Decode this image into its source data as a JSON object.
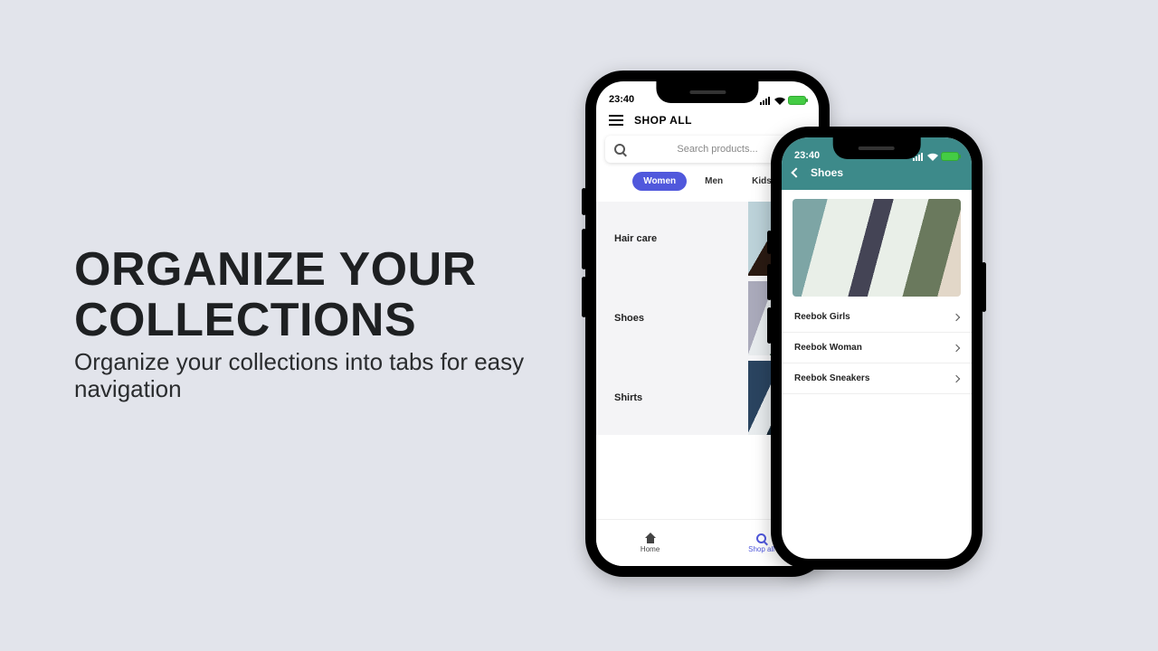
{
  "marketing": {
    "headline": "ORGANIZE YOUR COLLECTIONS",
    "subtext": "Organize your collections into tabs for easy navigation"
  },
  "phone1": {
    "status_time": "23:40",
    "header_title": "SHOP ALL",
    "search_placeholder": "Search products...",
    "tabs": {
      "t0": "Women",
      "t1": "Men",
      "t2": "Kids"
    },
    "collections": {
      "c0": "Hair care",
      "c1": "Shoes",
      "c2": "Shirts"
    },
    "nav": {
      "home": "Home",
      "shopall": "Shop all"
    }
  },
  "phone2": {
    "status_time": "23:40",
    "page_title": "Shoes",
    "items": {
      "i0": "Reebok Girls",
      "i1": "Reebok Woman",
      "i2": "Reebok Sneakers"
    }
  }
}
